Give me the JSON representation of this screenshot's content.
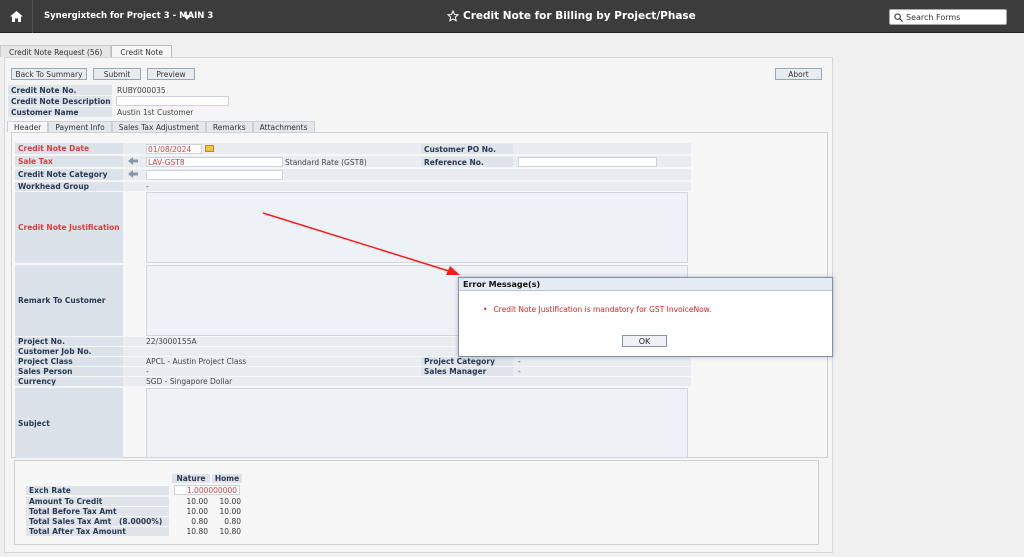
{
  "topbar": {
    "project": "Synergixtech for Project 3 - MAIN 3",
    "title": "Credit Note for Billing by Project/Phase",
    "search_placeholder": "Search Forms"
  },
  "outer_tabs": [
    "Credit Note Request (56)",
    "Credit Note"
  ],
  "toolbar": {
    "back": "Back To Summary",
    "submit": "Submit",
    "preview": "Preview",
    "abort": "Abort"
  },
  "info": {
    "no_label": "Credit Note No.",
    "no_value": "RUBY000035",
    "desc_label": "Credit Note Description",
    "cust_label": "Customer Name",
    "cust_value": "Austin 1st Customer"
  },
  "inner_tabs": [
    "Header",
    "Payment Info",
    "Sales Tax Adjustment",
    "Remarks",
    "Attachments"
  ],
  "form": {
    "date_label": "Credit Note Date",
    "date_value": "01/08/2024",
    "po_label": "Customer PO No.",
    "tax_label": "Sale Tax",
    "tax_value": "LAV-GST8",
    "tax_desc": "Standard Rate (GST8)",
    "ref_label": "Reference No.",
    "cat_label": "Credit Note Category",
    "wh_label": "Workhead Group",
    "wh_value": "-",
    "just_label": "Credit Note Justification",
    "remark_label": "Remark To Customer",
    "proj_label": "Project No.",
    "proj_value": "22/3000155A",
    "job_label": "Customer Job No.",
    "pclass_label": "Project Class",
    "pclass_value": "APCL - Austin Project Class",
    "pcat_label": "Project Category",
    "pcat_value": "-",
    "sp_label": "Sales Person",
    "sp_value": "-",
    "sm_label": "Sales Manager",
    "sm_value": "-",
    "cur_label": "Currency",
    "cur_value": "SGD - Singapore Dollar",
    "subject_label": "Subject"
  },
  "summary": {
    "col_nature": "Nature",
    "col_home": "Home",
    "rows": [
      {
        "label": "Exch Rate",
        "nature": "1.000000000",
        "home": ""
      },
      {
        "label": "Amount To Credit",
        "nature": "10.00",
        "home": "10.00"
      },
      {
        "label": "Total Before Tax Amt",
        "nature": "10.00",
        "home": "10.00"
      },
      {
        "label": "Total Sales Tax Amt   (8.0000%)",
        "nature": "0.80",
        "home": "0.80"
      },
      {
        "label": "Total After Tax Amount",
        "nature": "10.80",
        "home": "10.80"
      }
    ]
  },
  "dialog": {
    "title": "Error Message(s)",
    "message": "Credit Note Justification is mandatory for GST InvoiceNow.",
    "ok": "OK"
  },
  "colors": {
    "topbar": "#3c3c3c",
    "required": "#e03c3c",
    "error": "#d02828",
    "arrow": "#ff1a1a"
  },
  "icons": [
    "home-icon",
    "star-icon",
    "search-icon",
    "chevron-down-icon",
    "calendar-icon",
    "lookup-icon"
  ]
}
